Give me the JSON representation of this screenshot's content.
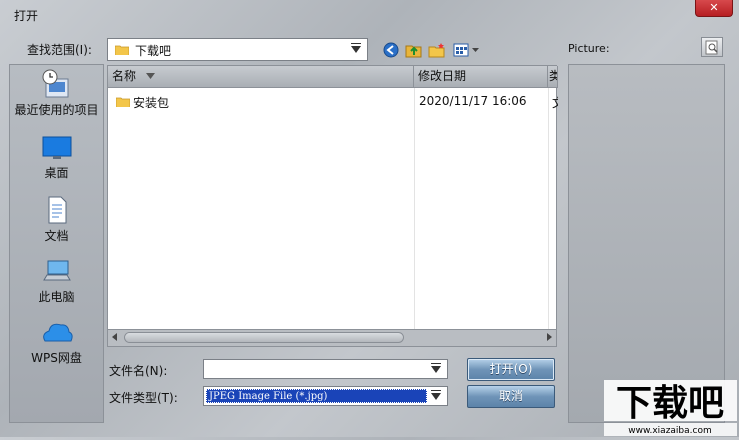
{
  "window": {
    "title": "打开",
    "close_glyph": "✕"
  },
  "lookin": {
    "label": "查找范围(I):",
    "value": "下载吧"
  },
  "toolbar": {
    "icons": [
      "back-icon",
      "up-folder-icon",
      "new-folder-icon",
      "view-menu-icon"
    ]
  },
  "places": [
    {
      "label": "最近使用的项目",
      "icon": "recent-items-icon"
    },
    {
      "label": "桌面",
      "icon": "desktop-icon"
    },
    {
      "label": "文档",
      "icon": "documents-icon"
    },
    {
      "label": "此电脑",
      "icon": "computer-icon"
    },
    {
      "label": "WPS网盘",
      "icon": "cloud-icon"
    }
  ],
  "filelist": {
    "columns": [
      "名称",
      "修改日期",
      "类"
    ],
    "rows": [
      {
        "name": "安装包",
        "date": "2020/11/17 16:06",
        "type": "文"
      }
    ]
  },
  "preview": {
    "label": "Picture:"
  },
  "filename": {
    "label": "文件名(N):",
    "value": ""
  },
  "filetype": {
    "label": "文件类型(T):",
    "value": "JPEG Image File (*.jpg)"
  },
  "buttons": {
    "open": "打开(O)",
    "cancel": "取消"
  },
  "watermark": {
    "brand": "下载吧",
    "url": "www.xiazaiba.com"
  },
  "colors": {
    "accent": "#1a44b8",
    "button": "#6f94b8",
    "close": "#c8282c"
  }
}
